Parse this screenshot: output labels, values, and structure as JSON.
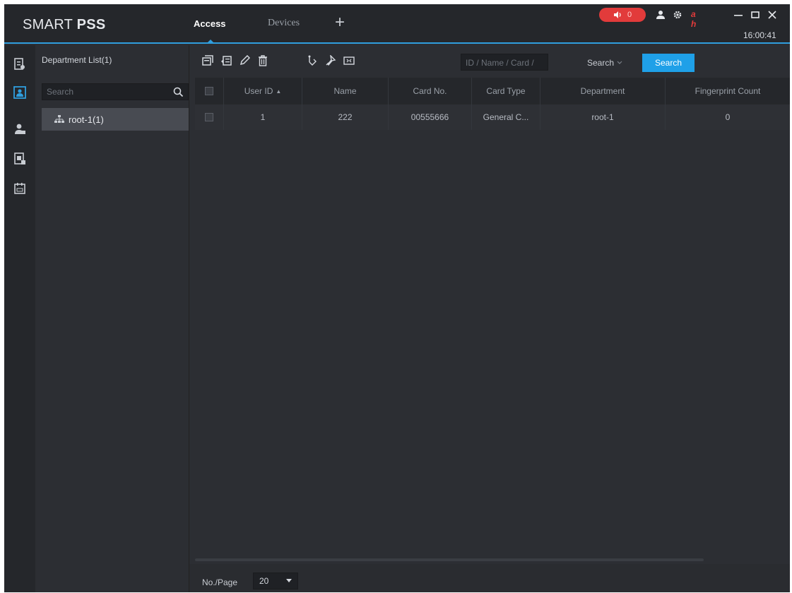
{
  "app": {
    "logo_light": "SMART ",
    "logo_bold": "PSS",
    "clock": "16:00:41"
  },
  "tabs": [
    {
      "label": "Access",
      "active": true
    },
    {
      "label": "Devices",
      "active": false
    }
  ],
  "header": {
    "alarm_count": "0",
    "add_tab_icon": "plus-icon"
  },
  "colors": {
    "accent": "#1fa0e8",
    "alarm": "#e23b3b",
    "background": "#2c2e33"
  },
  "department": {
    "title": "Department List(1)",
    "search_placeholder": "Search",
    "tree": [
      {
        "label": "root-1(1)",
        "icon": "org-tree-icon"
      }
    ]
  },
  "toolbar": {
    "search_placeholder": "ID / Name / Card /",
    "search_type": "Search",
    "search_button": "Search"
  },
  "table": {
    "columns": [
      "User ID",
      "Name",
      "Card No.",
      "Card Type",
      "Department",
      "Fingerprint Count"
    ],
    "sort_indicator": "▲",
    "rows": [
      {
        "user_id": "1",
        "name": "222",
        "card_no": "00555666",
        "card_type": "General C...",
        "department": "root-1",
        "fingerprint_count": "0"
      }
    ]
  },
  "footer": {
    "per_page_label": "No./Page",
    "per_page_value": "20"
  }
}
